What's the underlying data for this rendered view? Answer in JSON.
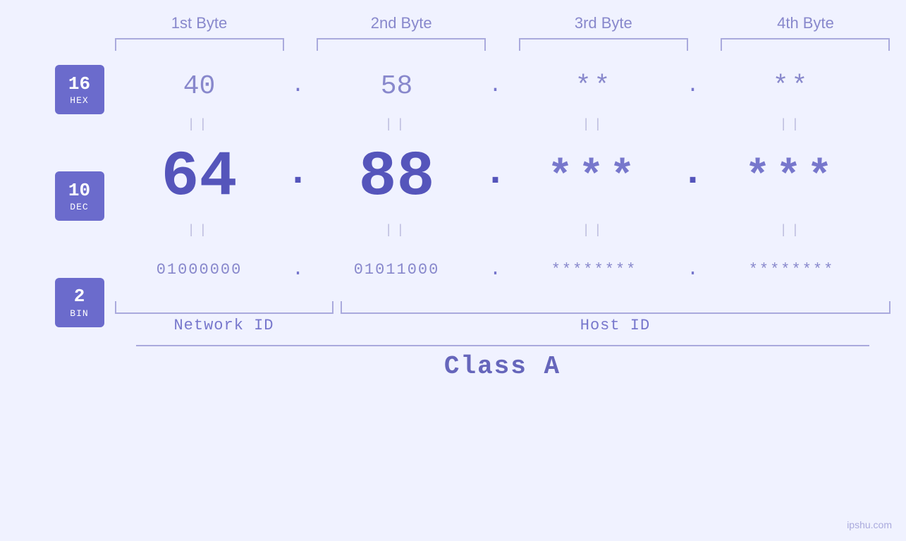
{
  "headers": {
    "byte1": "1st Byte",
    "byte2": "2nd Byte",
    "byte3": "3rd Byte",
    "byte4": "4th Byte"
  },
  "badges": {
    "hex": {
      "num": "16",
      "label": "HEX"
    },
    "dec": {
      "num": "10",
      "label": "DEC"
    },
    "bin": {
      "num": "2",
      "label": "BIN"
    }
  },
  "hex_row": {
    "b1": "40",
    "b2": "58",
    "b3": "**",
    "b4": "**"
  },
  "dec_row": {
    "b1": "64",
    "b2": "88",
    "b3": "***",
    "b4": "***"
  },
  "bin_row": {
    "b1": "01000000",
    "b2": "01011000",
    "b3": "********",
    "b4": "********"
  },
  "labels": {
    "network_id": "Network ID",
    "host_id": "Host ID",
    "class": "Class A"
  },
  "watermark": "ipshu.com"
}
